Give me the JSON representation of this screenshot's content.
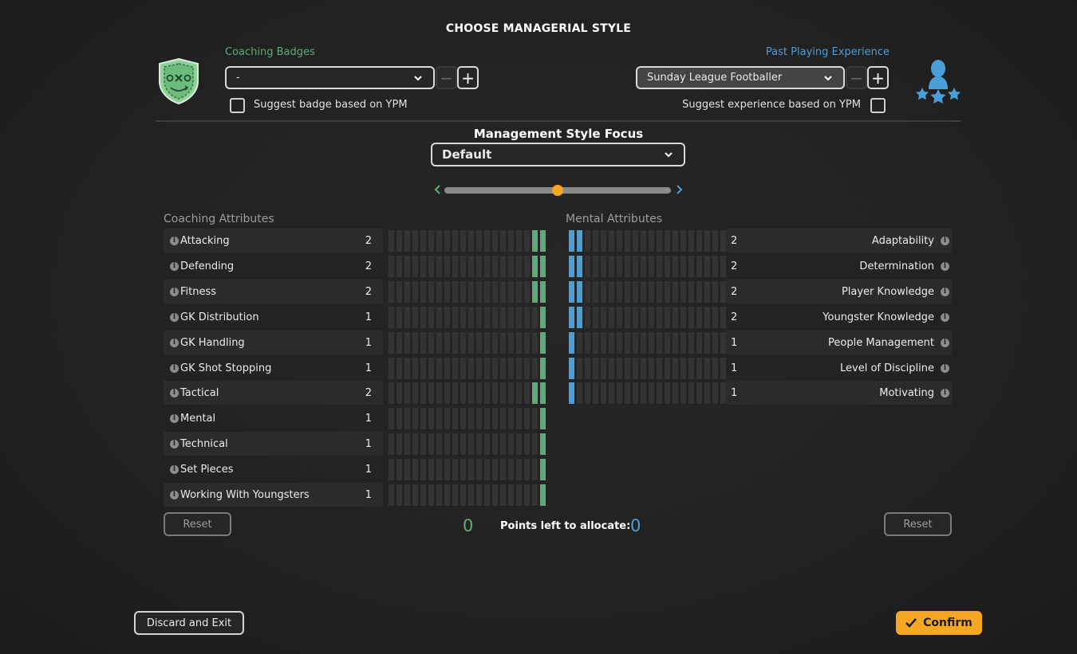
{
  "title": "CHOOSE MANAGERIAL STYLE",
  "coaching_badges": {
    "label": "Coaching Badges",
    "value": "-",
    "suggest_label": "Suggest badge based on YPM",
    "suggest_checked": false,
    "icon": "coaching-badge-shield-icon"
  },
  "playing_experience": {
    "label": "Past Playing Experience",
    "value": "Sunday League Footballer",
    "suggest_label": "Suggest experience based on YPM",
    "suggest_checked": false,
    "icon": "player-stars-icon"
  },
  "focus": {
    "title": "Management Style Focus",
    "value": "Default",
    "slider_value": 0.5
  },
  "coaching": {
    "label": "Coaching Attributes",
    "max": 20,
    "items": [
      {
        "name": "Attacking",
        "value": 2
      },
      {
        "name": "Defending",
        "value": 2
      },
      {
        "name": "Fitness",
        "value": 2
      },
      {
        "name": "GK Distribution",
        "value": 1
      },
      {
        "name": "GK Handling",
        "value": 1
      },
      {
        "name": "GK Shot Stopping",
        "value": 1
      },
      {
        "name": "Tactical",
        "value": 2
      },
      {
        "name": "Mental",
        "value": 1
      },
      {
        "name": "Technical",
        "value": 1
      },
      {
        "name": "Set Pieces",
        "value": 1
      },
      {
        "name": "Working With Youngsters",
        "value": 1
      }
    ]
  },
  "mental": {
    "label": "Mental Attributes",
    "max": 20,
    "items": [
      {
        "name": "Adaptability",
        "value": 2
      },
      {
        "name": "Determination",
        "value": 2
      },
      {
        "name": "Player Knowledge",
        "value": 2
      },
      {
        "name": "Youngster Knowledge",
        "value": 2
      },
      {
        "name": "People Management",
        "value": 1
      },
      {
        "name": "Level of Discipline",
        "value": 1
      },
      {
        "name": "Motivating",
        "value": 1
      }
    ]
  },
  "points": {
    "coaching_left": "0",
    "label": "Points left to allocate:",
    "mental_left": "0"
  },
  "buttons": {
    "reset": "Reset",
    "discard": "Discard and Exit",
    "confirm": "Confirm"
  },
  "colors": {
    "coaching": "#5fa97a",
    "mental": "#4a9fd8",
    "accent": "#f5a623"
  }
}
